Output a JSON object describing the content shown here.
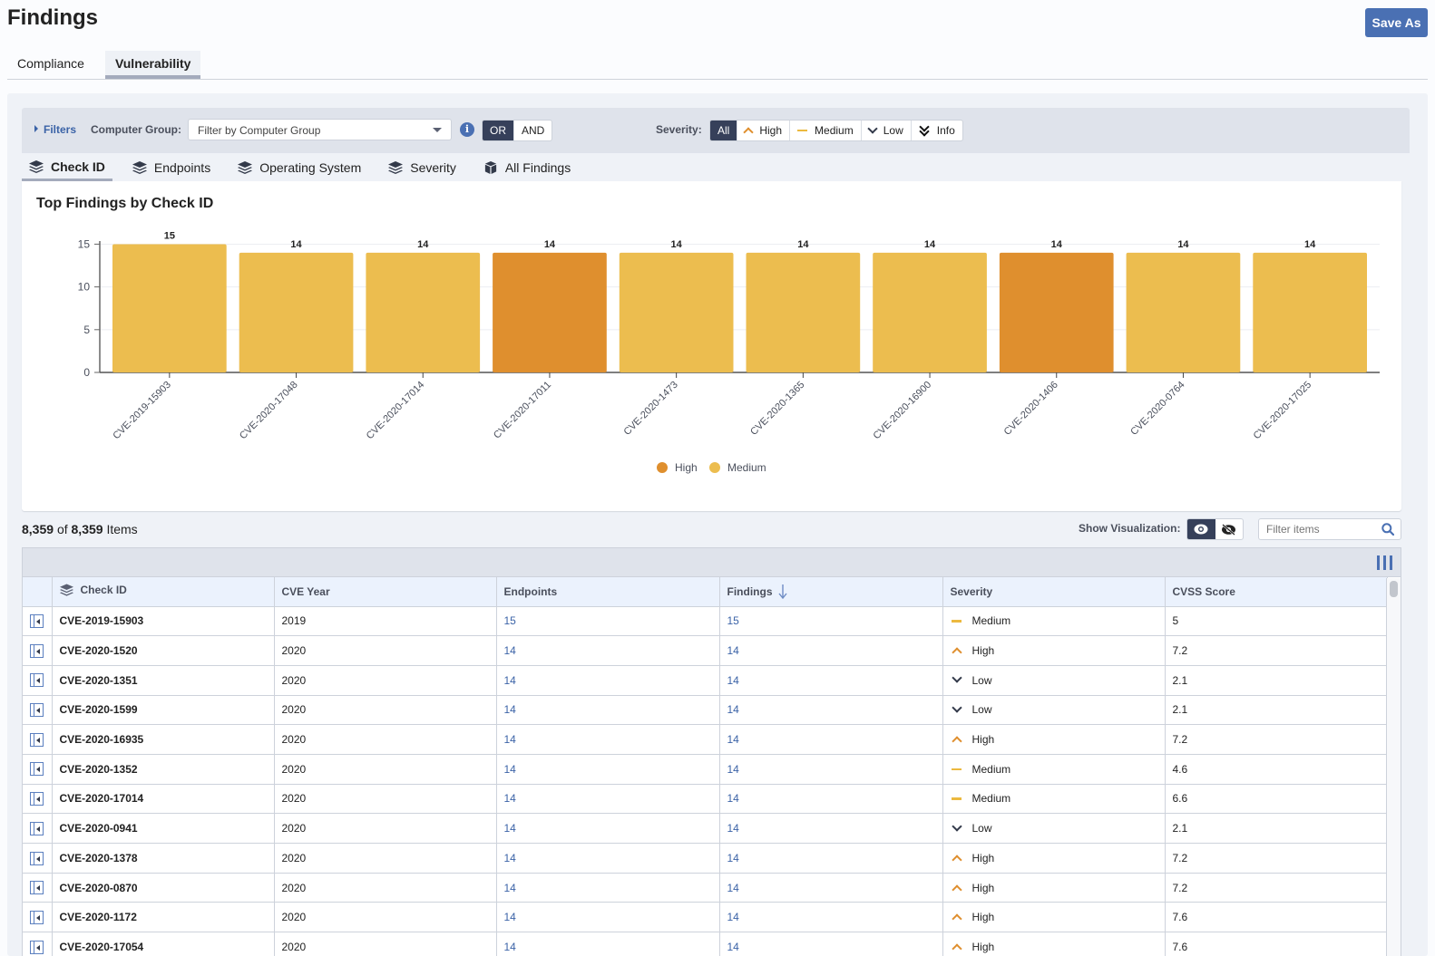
{
  "page": {
    "title": "Findings",
    "save_as_label": "Save As"
  },
  "top_tabs": [
    {
      "label": "Compliance",
      "active": false
    },
    {
      "label": "Vulnerability",
      "active": true
    }
  ],
  "filters": {
    "toggle_label": "Filters",
    "computer_group_label": "Computer Group:",
    "computer_group_placeholder": "Filter by Computer Group",
    "logic_options": [
      "OR",
      "AND"
    ],
    "logic_selected": "OR",
    "severity_label": "Severity:",
    "severity_options": [
      {
        "label": "All",
        "icon": "",
        "active": true
      },
      {
        "label": "High",
        "icon": "chevron-up-icon",
        "active": false
      },
      {
        "label": "Medium",
        "icon": "dash-icon",
        "active": false
      },
      {
        "label": "Low",
        "icon": "chevron-down-icon",
        "active": false
      },
      {
        "label": "Info",
        "icon": "double-chevron-down-icon",
        "active": false
      }
    ]
  },
  "view_tabs": [
    {
      "label": "Check ID",
      "icon": "layers-icon",
      "active": true
    },
    {
      "label": "Endpoints",
      "icon": "layers-icon",
      "active": false
    },
    {
      "label": "Operating System",
      "icon": "layers-icon",
      "active": false
    },
    {
      "label": "Severity",
      "icon": "layers-icon",
      "active": false
    },
    {
      "label": "All Findings",
      "icon": "cube-icon",
      "active": false
    }
  ],
  "colors": {
    "high": "#df8f2e",
    "medium": "#ecbd4f",
    "low": "#333a4a",
    "accent": "#4a70b3",
    "link": "#3b63a7"
  },
  "chart_data": {
    "type": "bar",
    "title": "Top Findings by Check ID",
    "xlabel": "",
    "ylabel": "",
    "ylim": [
      0,
      16
    ],
    "yticks": [
      0,
      5,
      10,
      15
    ],
    "grid": true,
    "legend_position": "bottom-center",
    "legend": [
      {
        "name": "High",
        "color": "#df8f2e"
      },
      {
        "name": "Medium",
        "color": "#ecbd4f"
      }
    ],
    "categories": [
      "CVE-2019-15903",
      "CVE-2020-17048",
      "CVE-2020-17014",
      "CVE-2020-17011",
      "CVE-2020-1473",
      "CVE-2020-1365",
      "CVE-2020-16900",
      "CVE-2020-1406",
      "CVE-2020-0764",
      "CVE-2020-17025"
    ],
    "values": [
      15,
      14,
      14,
      14,
      14,
      14,
      14,
      14,
      14,
      14
    ],
    "severity": [
      "Medium",
      "Medium",
      "Medium",
      "High",
      "Medium",
      "Medium",
      "Medium",
      "High",
      "Medium",
      "Medium"
    ]
  },
  "list": {
    "count_shown": "8,359",
    "count_of": "of",
    "count_total": "8,359",
    "count_suffix": "Items",
    "show_viz_label": "Show Visualization:",
    "filter_placeholder": "Filter items"
  },
  "table": {
    "columns": [
      "Check ID",
      "CVE Year",
      "Endpoints",
      "Findings",
      "Severity",
      "CVSS Score"
    ],
    "sorted_column": "Findings",
    "sort_direction": "desc",
    "rows": [
      {
        "check_id": "CVE-2019-15903",
        "cve_year": "2019",
        "endpoints": "15",
        "findings": "15",
        "severity": "Medium",
        "cvss": "5"
      },
      {
        "check_id": "CVE-2020-1520",
        "cve_year": "2020",
        "endpoints": "14",
        "findings": "14",
        "severity": "High",
        "cvss": "7.2"
      },
      {
        "check_id": "CVE-2020-1351",
        "cve_year": "2020",
        "endpoints": "14",
        "findings": "14",
        "severity": "Low",
        "cvss": "2.1"
      },
      {
        "check_id": "CVE-2020-1599",
        "cve_year": "2020",
        "endpoints": "14",
        "findings": "14",
        "severity": "Low",
        "cvss": "2.1"
      },
      {
        "check_id": "CVE-2020-16935",
        "cve_year": "2020",
        "endpoints": "14",
        "findings": "14",
        "severity": "High",
        "cvss": "7.2"
      },
      {
        "check_id": "CVE-2020-1352",
        "cve_year": "2020",
        "endpoints": "14",
        "findings": "14",
        "severity": "Medium",
        "cvss": "4.6"
      },
      {
        "check_id": "CVE-2020-17014",
        "cve_year": "2020",
        "endpoints": "14",
        "findings": "14",
        "severity": "Medium",
        "cvss": "6.6"
      },
      {
        "check_id": "CVE-2020-0941",
        "cve_year": "2020",
        "endpoints": "14",
        "findings": "14",
        "severity": "Low",
        "cvss": "2.1"
      },
      {
        "check_id": "CVE-2020-1378",
        "cve_year": "2020",
        "endpoints": "14",
        "findings": "14",
        "severity": "High",
        "cvss": "7.2"
      },
      {
        "check_id": "CVE-2020-0870",
        "cve_year": "2020",
        "endpoints": "14",
        "findings": "14",
        "severity": "High",
        "cvss": "7.2"
      },
      {
        "check_id": "CVE-2020-1172",
        "cve_year": "2020",
        "endpoints": "14",
        "findings": "14",
        "severity": "High",
        "cvss": "7.6"
      },
      {
        "check_id": "CVE-2020-17054",
        "cve_year": "2020",
        "endpoints": "14",
        "findings": "14",
        "severity": "High",
        "cvss": "7.6"
      }
    ]
  }
}
